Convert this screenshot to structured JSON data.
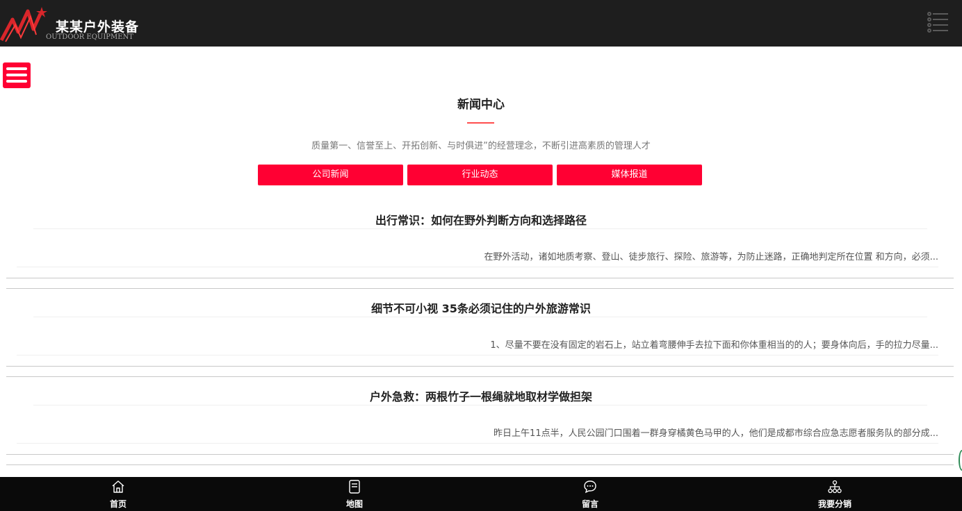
{
  "header": {
    "brand_name": "某某户外装备",
    "brand_sub": "OUTDOOR EQUIPMENT",
    "menu_icon": "list-menu-icon"
  },
  "floating_menu": {
    "icon": "hamburger-icon"
  },
  "section": {
    "title": "新闻中心",
    "description": "质量第一、信誉至上、开拓创新、与时俱进”的经营理念，不断引进高素质的管理人才"
  },
  "tabs": [
    "公司新闻",
    "行业动态",
    "媒体报道"
  ],
  "news": [
    {
      "title": "出行常识：如何在野外判断方向和选择路径",
      "summary": "在野外活动，诸如地质考察、登山、徒步旅行、探险、旅游等，为防止迷路，正确地判定所在位置 和方向，必须..."
    },
    {
      "title": "细节不可小视 35条必须记住的户外旅游常识",
      "summary": "1、尽量不要在没有固定的岩石上，站立着弯腰伸手去拉下面和你体重相当的的人；要身体向后，手的拉力尽量..."
    },
    {
      "title": "户外急救：两根竹子一根绳就地取材学做担架",
      "summary": "昨日上午11点半，人民公园门口围着一群身穿橘黄色马甲的人，他们是成都市综合应急志愿者服务队的部分成..."
    }
  ],
  "bottom_nav": [
    {
      "label": "首页",
      "icon": "home-icon"
    },
    {
      "label": "地图",
      "icon": "map-icon"
    },
    {
      "label": "留言",
      "icon": "message-icon"
    },
    {
      "label": "我要分销",
      "icon": "distribution-icon"
    }
  ],
  "colors": {
    "accent": "#ff0033",
    "header_bg": "#1e1e1e",
    "footer_bg": "#0a0a0a"
  }
}
